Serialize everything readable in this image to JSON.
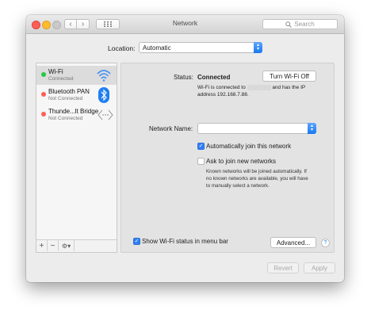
{
  "window": {
    "title": "Network"
  },
  "toolbar": {
    "back_glyph": "‹",
    "forward_glyph": "›",
    "search_placeholder": "Search",
    "search_icon": "magnifier-icon",
    "grid_icon": "show-all-grid-icon"
  },
  "location": {
    "label": "Location:",
    "value": "Automatic"
  },
  "services": [
    {
      "name": "Wi-Fi",
      "status": "Connected",
      "status_color": "#28c840",
      "icon": "wifi-icon"
    },
    {
      "name": "Bluetooth PAN",
      "status": "Not Connected",
      "status_color": "#fc5f57",
      "icon": "bluetooth-icon"
    },
    {
      "name": "Thunde...lt Bridge",
      "status": "Not Connected",
      "status_color": "#fc5f57",
      "icon": "thunderbolt-bridge-icon"
    }
  ],
  "sidebar_buttons": {
    "add": "+",
    "remove": "−",
    "action": "⚙▾"
  },
  "wifi": {
    "status_label": "Status:",
    "status_value": "Connected",
    "turn_off_button": "Turn Wi-Fi Off",
    "desc_1": "Wi-Fi is connected to",
    "desc_2": "and has the IP",
    "desc_3": "address 192.168.7.88.",
    "network_name_label": "Network Name:",
    "network_name_value": "",
    "auto_join_label": "Automatically join this network",
    "auto_join_checked": true,
    "ask_join_label": "Ask to join new networks",
    "ask_join_checked": false,
    "ask_join_help_1": "Known networks will be joined automatically. If",
    "ask_join_help_2": "no known networks are available, you will have",
    "ask_join_help_3": "to manually select a network.",
    "show_status_label": "Show Wi-Fi status in menu bar",
    "show_status_checked": true,
    "advanced_button": "Advanced...",
    "help_glyph": "?"
  },
  "footer": {
    "revert": "Revert",
    "apply": "Apply"
  },
  "colors": {
    "accent": "#2f7ff6",
    "close": "#fc5f57",
    "minimize": "#fdbc2e",
    "connected": "#28c840"
  }
}
